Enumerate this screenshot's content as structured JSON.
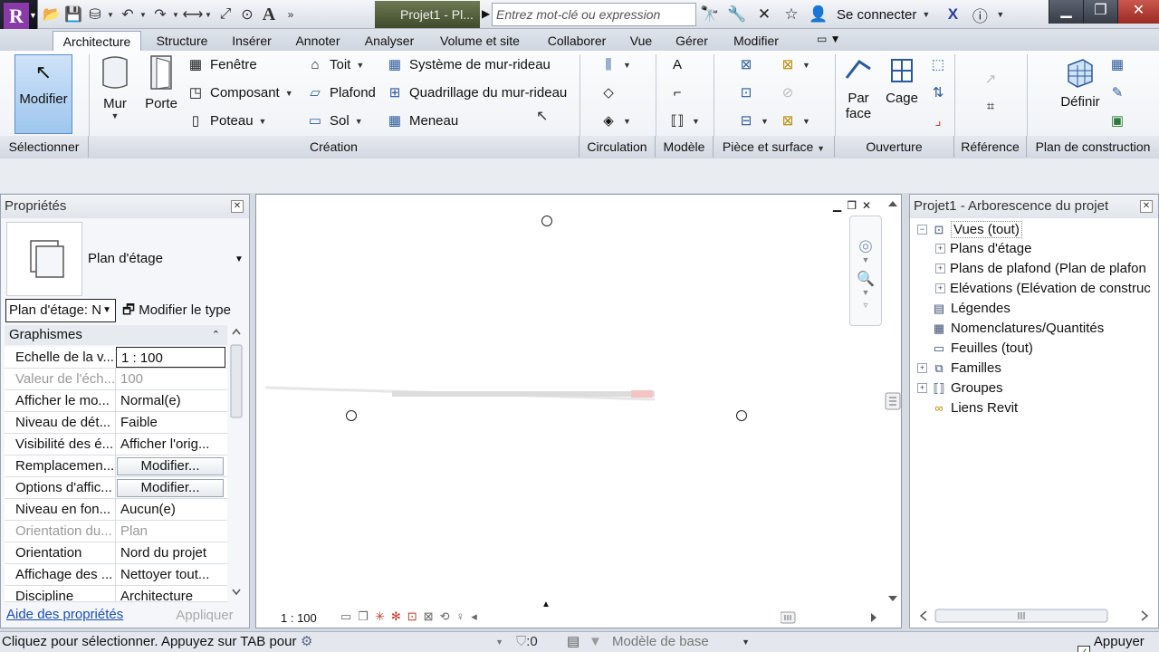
{
  "titlebar": {
    "doc_title": "Projet1 - Pl...",
    "search_placeholder": "Entrez mot-clé ou expression",
    "sign_in": "Se connecter",
    "app_logo": "R"
  },
  "tabs": [
    "Architecture",
    "Structure",
    "Insérer",
    "Annoter",
    "Analyser",
    "Volume et site",
    "Collaborer",
    "Vue",
    "Gérer",
    "Modifier"
  ],
  "ribbon": {
    "modify": "Modifier",
    "wall": "Mur",
    "door": "Porte",
    "window": "Fenêtre",
    "component": "Composant",
    "column": "Poteau",
    "roof": "Toit",
    "ceiling": "Plafond",
    "floor": "Sol",
    "curtain_system": "Système de mur-rideau",
    "curtain_grid": "Quadrillage du mur-rideau",
    "mullion": "Meneau",
    "by_face": "Par\nface",
    "by_face_l1": "Par",
    "by_face_l2": "face",
    "shaft": "Cage",
    "set": "Définir",
    "panels": [
      "Sélectionner",
      "Création",
      "Circulation",
      "Modèle",
      "Pièce et surface",
      "Ouverture",
      "Référence",
      "Plan de construction"
    ]
  },
  "properties": {
    "title": "Propriétés",
    "type_name": "Plan d'étage",
    "level_select": "Plan d'étage: N",
    "edit_type": "Modifier le type",
    "group": "Graphismes",
    "rows": [
      {
        "k": "Echelle de la v...",
        "v": "1 : 100"
      },
      {
        "k": "Valeur de l'éch...",
        "v": "100"
      },
      {
        "k": "Afficher le mo...",
        "v": "Normal(e)"
      },
      {
        "k": "Niveau de dét...",
        "v": "Faible"
      },
      {
        "k": "Visibilité des é...",
        "v": "Afficher l'orig..."
      },
      {
        "k": "Remplacemen...",
        "v": "Modifier..."
      },
      {
        "k": "Options d'affic...",
        "v": "Modifier..."
      },
      {
        "k": "Niveau en fon...",
        "v": "Aucun(e)"
      },
      {
        "k": "Orientation du...",
        "v": "Plan"
      },
      {
        "k": "Orientation",
        "v": "Nord du projet"
      },
      {
        "k": "Affichage des ...",
        "v": "Nettoyer tout..."
      },
      {
        "k": "Discipline",
        "v": "Architecture"
      }
    ],
    "help_link": "Aide des propriétés",
    "apply": "Appliquer"
  },
  "view": {
    "scale": "1 : 100"
  },
  "browser": {
    "title": "Projet1 - Arborescence du projet",
    "items": [
      {
        "label": "Vues (tout)"
      },
      {
        "label": "Plans d'étage"
      },
      {
        "label": "Plans de plafond (Plan de plafon"
      },
      {
        "label": "Elévations (Elévation de construc"
      },
      {
        "label": "Légendes"
      },
      {
        "label": "Nomenclatures/Quantités"
      },
      {
        "label": "Feuilles (tout)"
      },
      {
        "label": "Familles"
      },
      {
        "label": "Groupes"
      },
      {
        "label": "Liens Revit"
      }
    ]
  },
  "status": {
    "message": "Cliquez pour sélectionner. Appuyez sur TAB pour",
    "count": ":0",
    "model": "Modèle de base",
    "press_drag": "Appuyer et"
  },
  "colors": {
    "accent": "#9fc6ee",
    "app_purple": "#8a3aa8",
    "link": "#1a4fb3"
  }
}
